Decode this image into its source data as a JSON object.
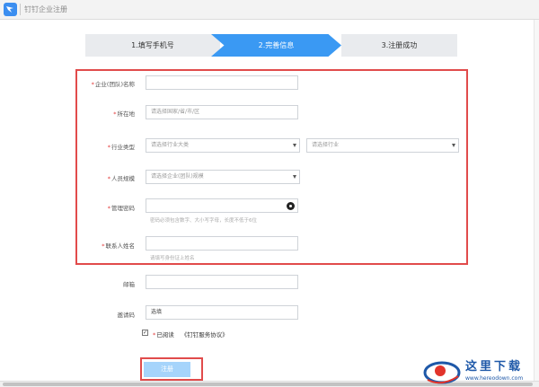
{
  "window": {
    "title": "钉钉企业注册"
  },
  "steps": [
    {
      "label": "1.填写手机号",
      "active": false
    },
    {
      "label": "2.完善信息",
      "active": true
    },
    {
      "label": "3.注册成功",
      "active": false
    }
  ],
  "form": {
    "company_name": {
      "label": "企业(团队)名称",
      "required": true,
      "value": ""
    },
    "location": {
      "label": "所在地",
      "required": true,
      "placeholder": "请选择国家/省/市/区"
    },
    "industry": {
      "label": "行业类型",
      "required": true,
      "major_placeholder": "请选择行业大类",
      "minor_placeholder": "请选择行业"
    },
    "staff_size": {
      "label": "人员规模",
      "required": true,
      "placeholder": "请选择企业(团队)规模"
    },
    "admin_password": {
      "label": "管理密码",
      "required": true,
      "hint": "密码必须包含数字、大小写字母，长度不低于6位"
    },
    "contact_name": {
      "label": "联系人姓名",
      "required": true,
      "hint": "请填写身份证上姓名"
    },
    "email": {
      "label": "邮箱",
      "required": false,
      "value": ""
    },
    "invite_code": {
      "label": "邀请码",
      "required": false,
      "value": "选填"
    },
    "agreement": {
      "checked": true,
      "text": "已阅读",
      "link": "《钉钉服务协议》"
    },
    "submit_label": "注册"
  },
  "watermark": {
    "text": "这里下载",
    "url": "www.hereodown.com"
  },
  "colors": {
    "accent": "#3a99f3",
    "highlight_box": "#e14b4b",
    "submit_disabled": "#a6d4fb"
  }
}
